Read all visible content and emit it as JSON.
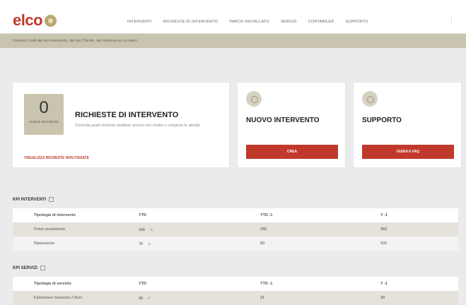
{
  "brand": {
    "name": "elco"
  },
  "nav": {
    "items": [
      "INTERVENTI",
      "RICHIESTE DI INTERVENTO",
      "PARCO INSTALLATO",
      "SERVIZI",
      "CONTABILER",
      "SUPPORTO"
    ]
  },
  "banner": {
    "text": "Inserisci i dati del tuo intervento, del tuo Cliente, del sistema su cui operi."
  },
  "requests_card": {
    "count": "0",
    "count_label": "NUOVE RICHIESTE",
    "title": "RICHIESTE DI INTERVENTO",
    "description": "Controlla quali richieste risultano ancora non risolte o completa le attività.",
    "link": "VISUALIZZA RICHIESTE NON FISSATE"
  },
  "new_card": {
    "title": "NUOVO INTERVENTO",
    "button": "CREA"
  },
  "support_card": {
    "title": "SUPPORTO",
    "button": "GUIDA E FAQ"
  },
  "kpi_interventi": {
    "title": "KPI INTERVENTI",
    "headers": [
      "Tipologia di intervento",
      "YTD",
      "YTD -1",
      "Y -1"
    ],
    "rows": [
      {
        "label": "Primo avviamento",
        "ytd": "166",
        "ytd1": "240",
        "y1": "369"
      },
      {
        "label": "Riparazione",
        "ytd": "76",
        "ytd1": "60",
        "y1": "102"
      }
    ]
  },
  "kpi_servizi": {
    "title": "KPI SERVIZI",
    "headers": [
      "Tipologia di servizio",
      "YTD",
      "YTD -1",
      "Y -1"
    ],
    "rows": [
      {
        "label": "Estensione Garanzia 2 Anni",
        "ytd": "26",
        "ytd1": "21",
        "y1": "39"
      }
    ]
  },
  "colors": {
    "accent": "#c0392b",
    "sand": "#c9c4ad"
  },
  "icons": [
    "menu-dots-icon",
    "wrench-icon",
    "support-icon",
    "info-icon",
    "trend-down-icon",
    "trend-up-icon"
  ]
}
